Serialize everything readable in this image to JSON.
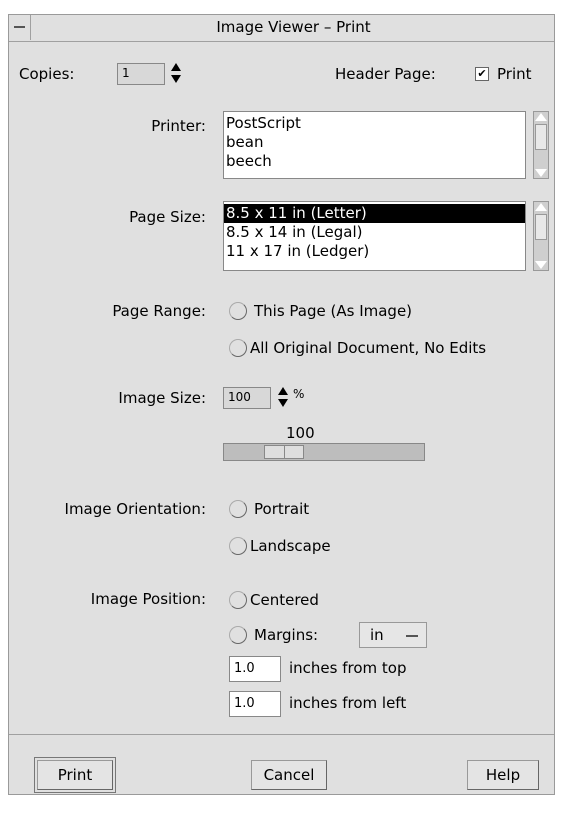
{
  "window": {
    "title": "Image Viewer – Print"
  },
  "copies": {
    "label": "Copies:",
    "value": "1"
  },
  "header_page": {
    "label": "Header Page:",
    "checkbox_label": "Print",
    "checked": true,
    "check_glyph": "✔"
  },
  "printer": {
    "label": "Printer:",
    "items": [
      "PostScript",
      "bean",
      "beech"
    ]
  },
  "page_size": {
    "label": "Page Size:",
    "items": [
      "8.5 x 11 in (Letter)",
      "8.5 x 14 in (Legal)",
      "11 x 17 in (Ledger)"
    ],
    "selected_index": 0
  },
  "page_range": {
    "label": "Page Range:",
    "options": [
      "This Page (As Image)",
      "All Original Document, No Edits"
    ]
  },
  "image_size": {
    "label": "Image Size:",
    "value": "100",
    "unit": "%",
    "slider_value": "100",
    "slider_min": 0,
    "slider_max": 400
  },
  "image_orientation": {
    "label": "Image Orientation:",
    "options": [
      "Portrait",
      "Landscape"
    ]
  },
  "image_position": {
    "label": "Image Position:",
    "centered_label": "Centered",
    "margins_label": "Margins:",
    "unit_selected": "in",
    "top_value": "1.0",
    "top_label": "inches from top",
    "left_value": "1.0",
    "left_label": "inches from left"
  },
  "buttons": {
    "print": "Print",
    "cancel": "Cancel",
    "help": "Help"
  }
}
